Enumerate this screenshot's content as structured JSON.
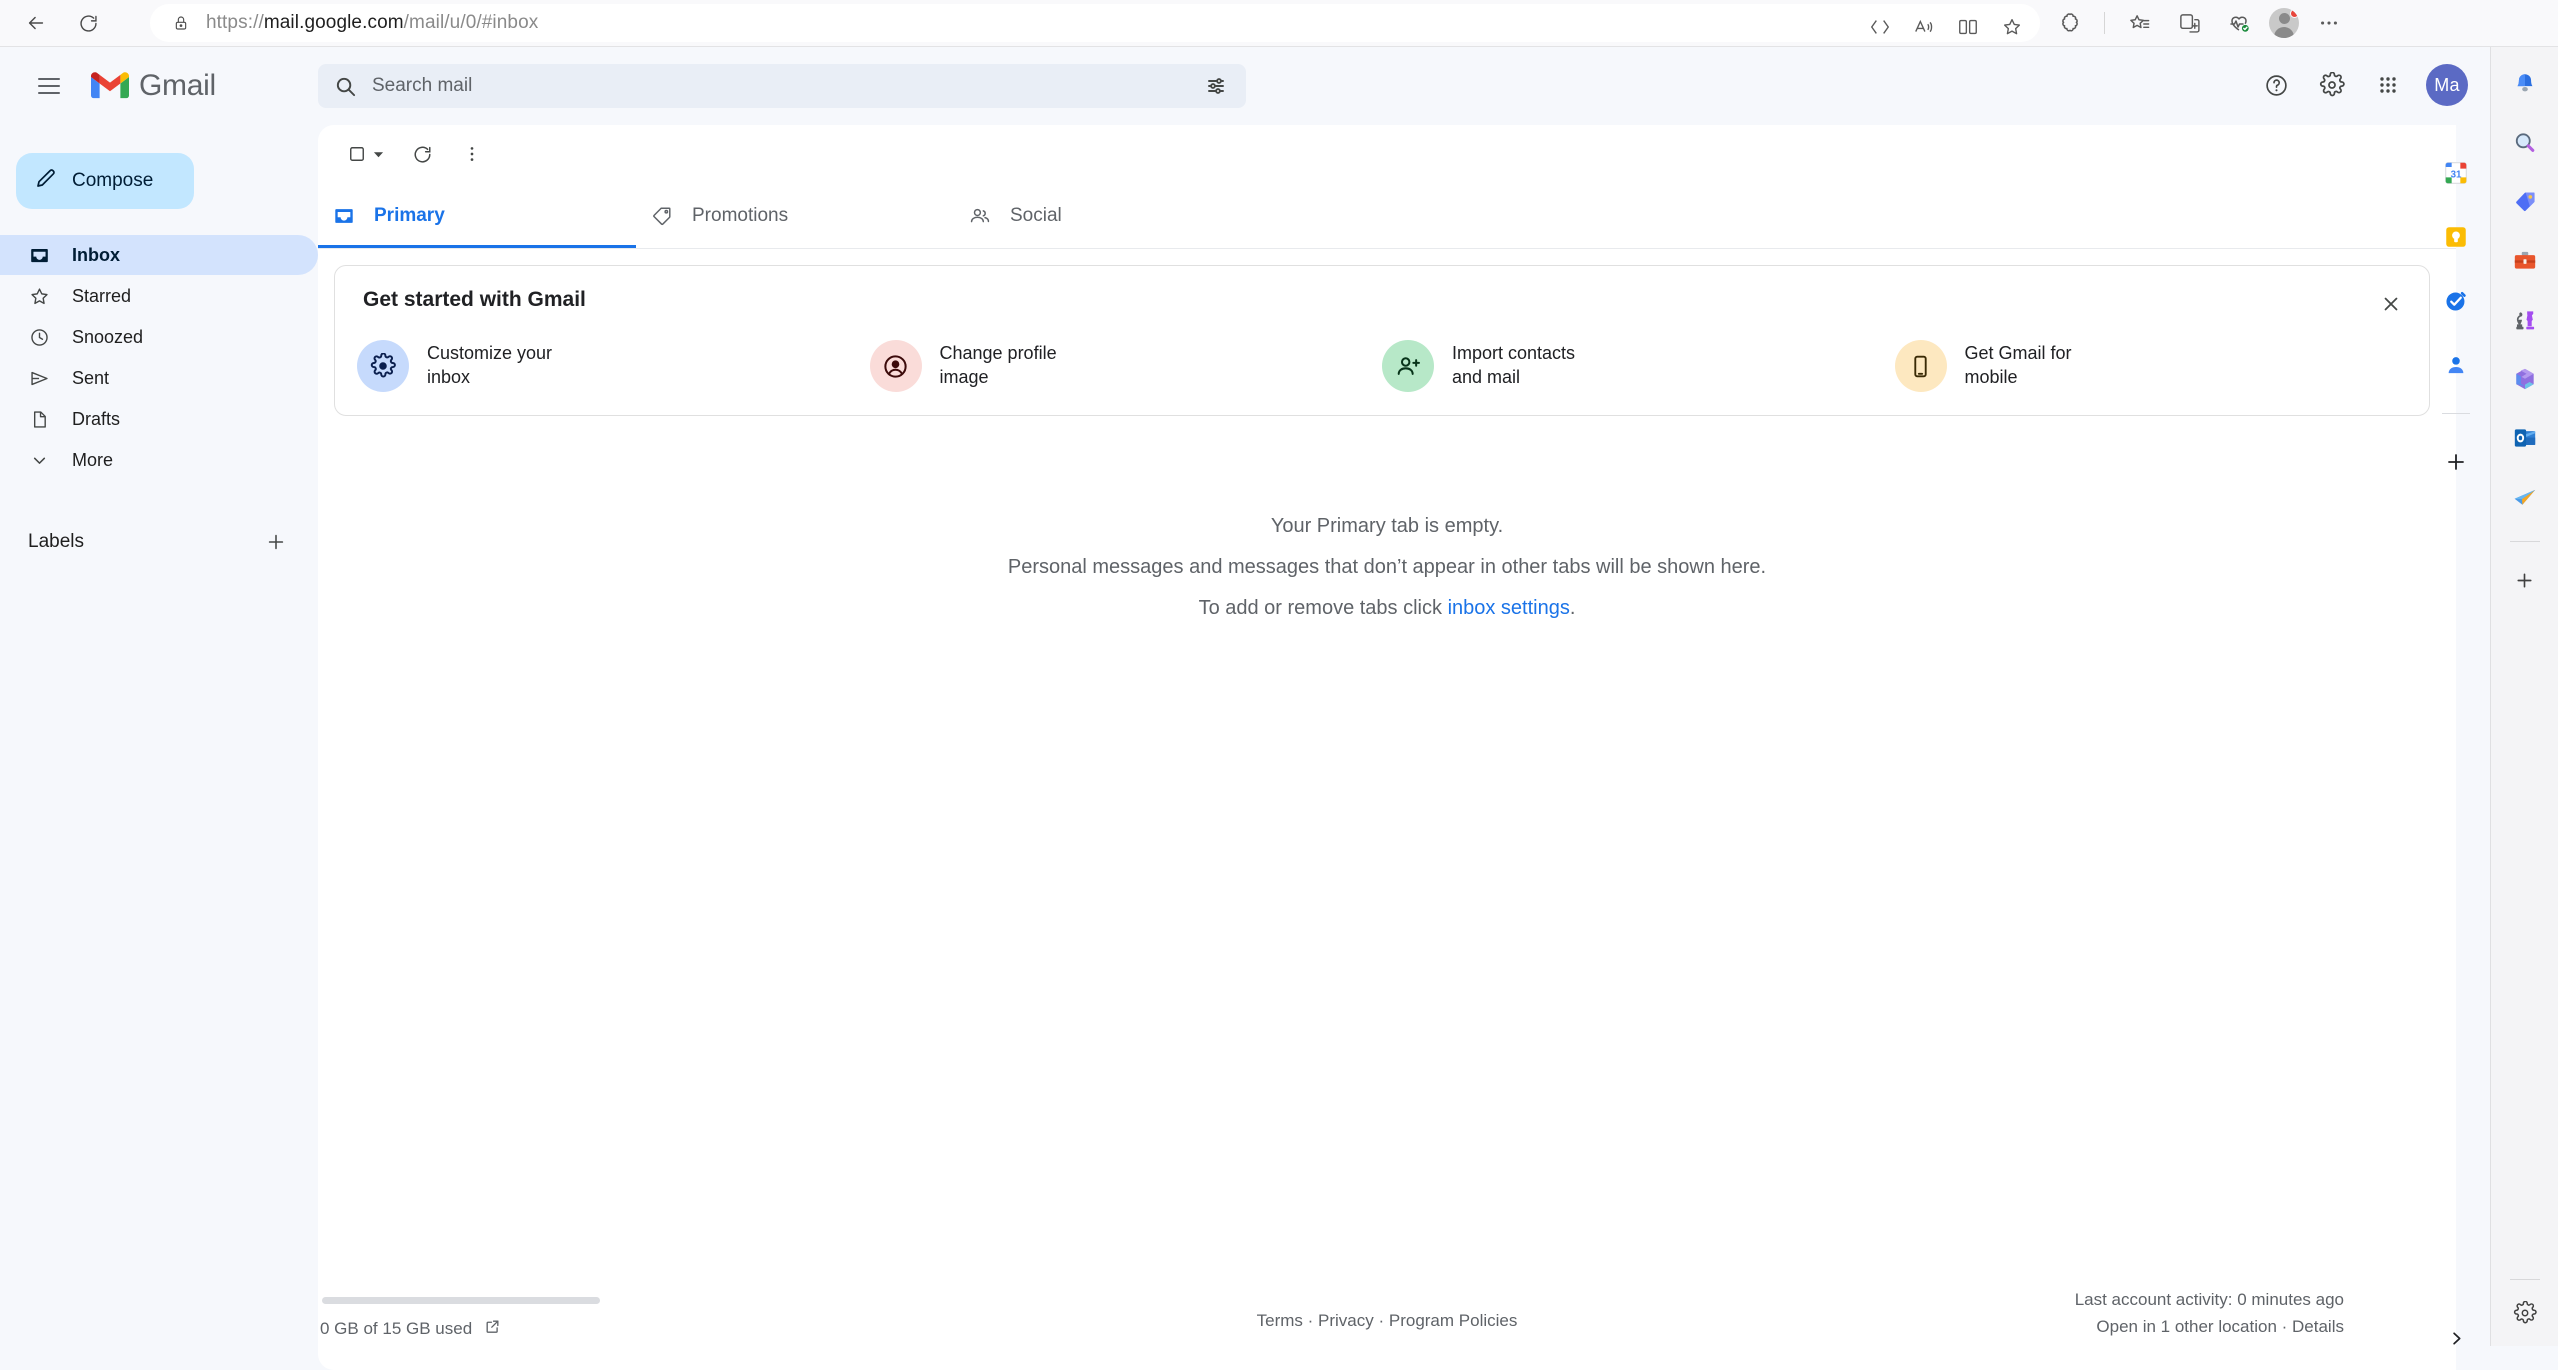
{
  "browser": {
    "url_prefix": "https://",
    "url_bold": "mail.google.com",
    "url_suffix": "/mail/u/0/#inbox",
    "back_label": "Back",
    "refresh_label": "Refresh",
    "omnibox_icons": [
      "split-screen-icon",
      "read-aloud-icon",
      "split-view-icon",
      "favorite-star-icon"
    ],
    "toolbar_icons": [
      "copilot-icon",
      "collections-icon",
      "browser-essentials-icon",
      "profile-avatar",
      "settings-more-icon"
    ]
  },
  "header": {
    "app_name": "Gmail",
    "menu_label": "Main menu",
    "help_label": "Support",
    "settings_label": "Settings",
    "apps_label": "Google apps",
    "avatar_initials": "Ma",
    "avatar_color": "#5b6ac4"
  },
  "search": {
    "placeholder": "Search mail",
    "value": "",
    "filter_label": "Show search options"
  },
  "sidebar": {
    "compose_label": "Compose",
    "items": [
      {
        "label": "Inbox",
        "icon": "inbox-icon",
        "active": true
      },
      {
        "label": "Starred",
        "icon": "star-icon",
        "active": false
      },
      {
        "label": "Snoozed",
        "icon": "clock-icon",
        "active": false
      },
      {
        "label": "Sent",
        "icon": "send-icon",
        "active": false
      },
      {
        "label": "Drafts",
        "icon": "draft-icon",
        "active": false
      },
      {
        "label": "More",
        "icon": "chevron-down-icon",
        "active": false
      }
    ],
    "labels_heading": "Labels",
    "add_label_title": "Create new label"
  },
  "toolbar": {
    "select_label": "Select",
    "refresh_label": "Refresh",
    "more_label": "More"
  },
  "tabs": [
    {
      "label": "Primary",
      "icon": "inbox-icon",
      "active": true
    },
    {
      "label": "Promotions",
      "icon": "tag-icon",
      "active": false
    },
    {
      "label": "Social",
      "icon": "people-icon",
      "active": false
    }
  ],
  "get_started": {
    "title": "Get started with Gmail",
    "close_label": "Close",
    "items": [
      {
        "line1": "Customize your",
        "line2": "inbox",
        "icon": "gear-icon",
        "bg": "#c6dafc",
        "fg": "#0b1f4e"
      },
      {
        "line1": "Change profile",
        "line2": "image",
        "icon": "account-circle-icon",
        "bg": "#fadcd9",
        "fg": "#3c0a0a"
      },
      {
        "line1": "Import contacts",
        "line2": "and mail",
        "icon": "person-add-icon",
        "bg": "#b7e8c8",
        "fg": "#08341a"
      },
      {
        "line1": "Get Gmail for",
        "line2": "mobile",
        "icon": "phone-icon",
        "bg": "#fde8c0",
        "fg": "#3a2a05"
      }
    ]
  },
  "empty_state": {
    "line1": "Your Primary tab is empty.",
    "line2": "Personal messages and messages that don’t appear in other tabs will be shown here.",
    "line3_prefix": "To add or remove tabs click ",
    "line3_link": "inbox settings",
    "line3_suffix": "."
  },
  "footer": {
    "storage_text": "0 GB of 15 GB used",
    "storage_link_label": "Manage storage",
    "legal": "Terms · Privacy · Program Policies",
    "activity_line1": "Last account activity: 0 minutes ago",
    "activity_line2": "Open in 1 other location · Details"
  },
  "gmail_side_panel": {
    "items": [
      {
        "name": "google-calendar-icon",
        "label": "Calendar",
        "badge": "31"
      },
      {
        "name": "google-keep-icon",
        "label": "Keep"
      },
      {
        "name": "google-tasks-icon",
        "label": "Tasks"
      },
      {
        "name": "google-contacts-icon",
        "label": "Contacts"
      }
    ],
    "add_label": "Get add-ons",
    "expand_label": "Show side panel"
  },
  "edge_sidebar": {
    "items": [
      {
        "name": "notifications-bell-icon",
        "label": "Notifications"
      },
      {
        "name": "search-icon",
        "label": "Search"
      },
      {
        "name": "shopping-tag-icon",
        "label": "Shopping"
      },
      {
        "name": "tools-icon",
        "label": "Tools"
      },
      {
        "name": "games-icon",
        "label": "Games"
      },
      {
        "name": "microsoft-365-icon",
        "label": "Microsoft 365"
      },
      {
        "name": "outlook-icon",
        "label": "Outlook"
      },
      {
        "name": "send-paperplane-icon",
        "label": "Drop"
      }
    ],
    "add_label": "Customize",
    "settings_label": "Sidebar settings"
  },
  "colors": {
    "accent_blue": "#1a73e8",
    "compose_bg": "#c2e7ff",
    "active_nav_bg": "#d3e3fd",
    "page_bg": "#f6f8fc"
  }
}
